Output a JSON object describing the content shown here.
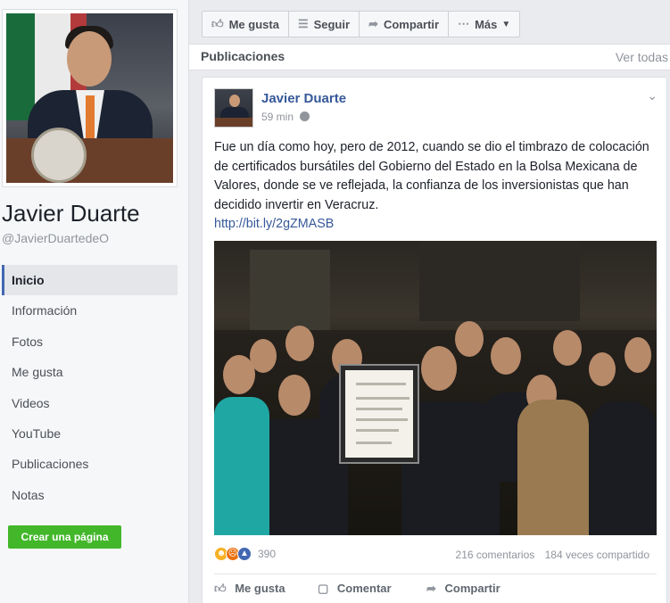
{
  "profile": {
    "name": "Javier Duarte",
    "handle": "@JavierDuartedeO"
  },
  "left_nav": {
    "items": [
      {
        "label": "Inicio",
        "active": true
      },
      {
        "label": "Información"
      },
      {
        "label": "Fotos"
      },
      {
        "label": "Me gusta"
      },
      {
        "label": "Videos"
      },
      {
        "label": "YouTube"
      },
      {
        "label": "Publicaciones"
      },
      {
        "label": "Notas"
      }
    ],
    "create_page": "Crear una página"
  },
  "actions_bar": {
    "like": "Me gusta",
    "follow": "Seguir",
    "share": "Compartir",
    "more": "Más"
  },
  "publications": {
    "title": "Publicaciones",
    "see_all": "Ver todas"
  },
  "post": {
    "author": "Javier Duarte",
    "time": "59 min",
    "text": "Fue un día como hoy, pero de 2012, cuando se dio el timbrazo de colocación de certificados bursátiles del Gobierno del Estado en la Bolsa Mexicana de Valores, donde se ve reflejada, la confianza de los inversionistas que han decidido invertir en Veracruz.",
    "link": "http://bit.ly/2gZMASB",
    "reaction_count": "390",
    "comments": "216 comentarios",
    "shares": "184 veces compartido",
    "actions": {
      "like": "Me gusta",
      "comment": "Comentar",
      "share": "Compartir"
    }
  },
  "colors": {
    "link_blue": "#365899",
    "brand_blue": "#4267b2",
    "create_green": "#42b72a",
    "background": "#e9ebee"
  },
  "icons": [
    "thumbs-up-icon",
    "rss-icon",
    "share-arrow-icon",
    "ellipsis-icon",
    "caret-down-icon",
    "globe-icon",
    "chevron-down-icon",
    "comment-icon"
  ]
}
